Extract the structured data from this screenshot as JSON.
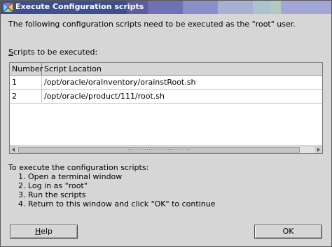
{
  "window": {
    "title": "Execute Configuration scripts",
    "title_strip_colors": [
      "#3f4f8e",
      "#5c5d9e",
      "#6f71b4",
      "#8b8ec9",
      "#a2a6d6",
      "#a9c3cf",
      "#b4c8c2",
      "#a7b0d2"
    ]
  },
  "intro_text": "The following configuration scripts need to be executed as the \"root\" user.",
  "scripts_label": {
    "mnemonic": "S",
    "rest": "cripts to be executed:"
  },
  "table": {
    "columns": [
      "Number",
      "Script Location"
    ],
    "rows": [
      {
        "number": "1",
        "location": "/opt/oracle/oraInventory/orainstRoot.sh"
      },
      {
        "number": "2",
        "location": "/opt/oracle/product/111/root.sh"
      }
    ]
  },
  "instructions": {
    "title": "To execute the configuration scripts:",
    "steps": [
      "1. Open a terminal window",
      "2. Log in as \"root\"",
      "3. Run the scripts",
      "4. Return to this window and click \"OK\" to continue"
    ]
  },
  "buttons": {
    "help_mnemonic": "H",
    "help_rest": "elp",
    "ok": "OK"
  },
  "icons": {
    "window_icon": "application-icon",
    "scroll_left": "triangle-left-icon",
    "scroll_right": "triangle-right-icon"
  }
}
